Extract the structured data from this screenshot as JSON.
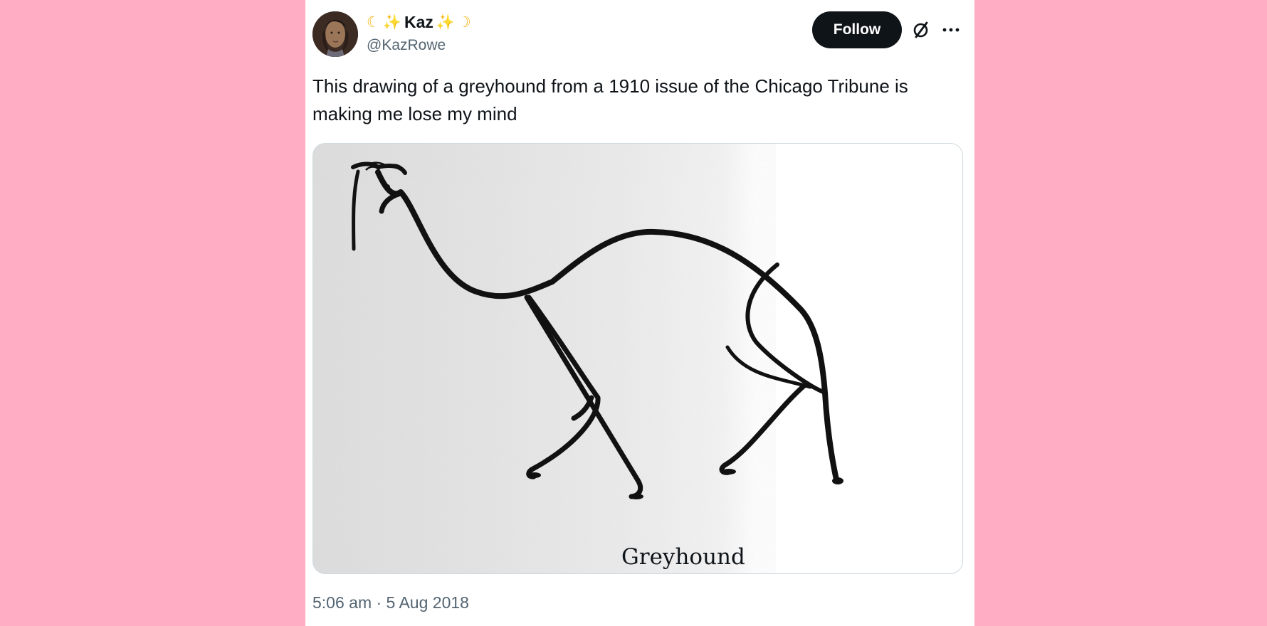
{
  "page": {
    "background": "#ffadc5",
    "card_background": "#ffffff",
    "text_color": "#0f1419",
    "secondary_text_color": "#536471",
    "border_color": "#cfd9de"
  },
  "user": {
    "display_name": "Kaz",
    "handle": "@KazRowe",
    "name_emojis": {
      "left_moon": "☾",
      "left_sparkle": "✨",
      "right_sparkle": "✨",
      "right_moon": "☽"
    }
  },
  "actions": {
    "follow_label": "Follow",
    "grok_icon": "slashed-circle-icon",
    "more_icon": "more-horizontal-icon"
  },
  "tweet": {
    "text": "This drawing of a greyhound from a 1910 issue of the Chicago Tribune is\nmaking me lose my mind",
    "image_caption": "Greyhound",
    "timestamp": "5:06 am · 5 Aug 2018"
  }
}
